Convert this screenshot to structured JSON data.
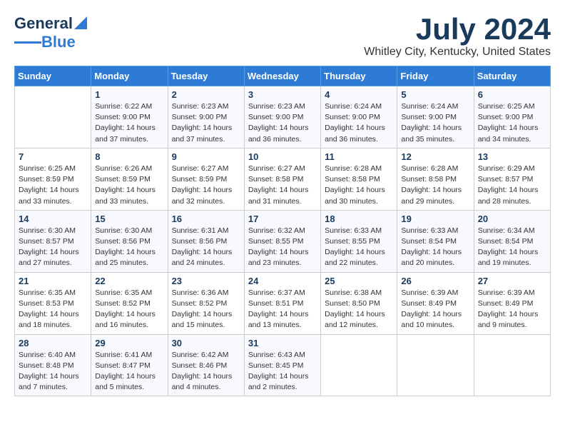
{
  "header": {
    "logo": {
      "line1": "General",
      "line2": "Blue"
    },
    "month": "July 2024",
    "location": "Whitley City, Kentucky, United States"
  },
  "weekdays": [
    "Sunday",
    "Monday",
    "Tuesday",
    "Wednesday",
    "Thursday",
    "Friday",
    "Saturday"
  ],
  "weeks": [
    [
      {
        "day": "",
        "info": ""
      },
      {
        "day": "1",
        "info": "Sunrise: 6:22 AM\nSunset: 9:00 PM\nDaylight: 14 hours\nand 37 minutes."
      },
      {
        "day": "2",
        "info": "Sunrise: 6:23 AM\nSunset: 9:00 PM\nDaylight: 14 hours\nand 37 minutes."
      },
      {
        "day": "3",
        "info": "Sunrise: 6:23 AM\nSunset: 9:00 PM\nDaylight: 14 hours\nand 36 minutes."
      },
      {
        "day": "4",
        "info": "Sunrise: 6:24 AM\nSunset: 9:00 PM\nDaylight: 14 hours\nand 36 minutes."
      },
      {
        "day": "5",
        "info": "Sunrise: 6:24 AM\nSunset: 9:00 PM\nDaylight: 14 hours\nand 35 minutes."
      },
      {
        "day": "6",
        "info": "Sunrise: 6:25 AM\nSunset: 9:00 PM\nDaylight: 14 hours\nand 34 minutes."
      }
    ],
    [
      {
        "day": "7",
        "info": "Sunrise: 6:25 AM\nSunset: 8:59 PM\nDaylight: 14 hours\nand 33 minutes."
      },
      {
        "day": "8",
        "info": "Sunrise: 6:26 AM\nSunset: 8:59 PM\nDaylight: 14 hours\nand 33 minutes."
      },
      {
        "day": "9",
        "info": "Sunrise: 6:27 AM\nSunset: 8:59 PM\nDaylight: 14 hours\nand 32 minutes."
      },
      {
        "day": "10",
        "info": "Sunrise: 6:27 AM\nSunset: 8:58 PM\nDaylight: 14 hours\nand 31 minutes."
      },
      {
        "day": "11",
        "info": "Sunrise: 6:28 AM\nSunset: 8:58 PM\nDaylight: 14 hours\nand 30 minutes."
      },
      {
        "day": "12",
        "info": "Sunrise: 6:28 AM\nSunset: 8:58 PM\nDaylight: 14 hours\nand 29 minutes."
      },
      {
        "day": "13",
        "info": "Sunrise: 6:29 AM\nSunset: 8:57 PM\nDaylight: 14 hours\nand 28 minutes."
      }
    ],
    [
      {
        "day": "14",
        "info": "Sunrise: 6:30 AM\nSunset: 8:57 PM\nDaylight: 14 hours\nand 27 minutes."
      },
      {
        "day": "15",
        "info": "Sunrise: 6:30 AM\nSunset: 8:56 PM\nDaylight: 14 hours\nand 25 minutes."
      },
      {
        "day": "16",
        "info": "Sunrise: 6:31 AM\nSunset: 8:56 PM\nDaylight: 14 hours\nand 24 minutes."
      },
      {
        "day": "17",
        "info": "Sunrise: 6:32 AM\nSunset: 8:55 PM\nDaylight: 14 hours\nand 23 minutes."
      },
      {
        "day": "18",
        "info": "Sunrise: 6:33 AM\nSunset: 8:55 PM\nDaylight: 14 hours\nand 22 minutes."
      },
      {
        "day": "19",
        "info": "Sunrise: 6:33 AM\nSunset: 8:54 PM\nDaylight: 14 hours\nand 20 minutes."
      },
      {
        "day": "20",
        "info": "Sunrise: 6:34 AM\nSunset: 8:54 PM\nDaylight: 14 hours\nand 19 minutes."
      }
    ],
    [
      {
        "day": "21",
        "info": "Sunrise: 6:35 AM\nSunset: 8:53 PM\nDaylight: 14 hours\nand 18 minutes."
      },
      {
        "day": "22",
        "info": "Sunrise: 6:35 AM\nSunset: 8:52 PM\nDaylight: 14 hours\nand 16 minutes."
      },
      {
        "day": "23",
        "info": "Sunrise: 6:36 AM\nSunset: 8:52 PM\nDaylight: 14 hours\nand 15 minutes."
      },
      {
        "day": "24",
        "info": "Sunrise: 6:37 AM\nSunset: 8:51 PM\nDaylight: 14 hours\nand 13 minutes."
      },
      {
        "day": "25",
        "info": "Sunrise: 6:38 AM\nSunset: 8:50 PM\nDaylight: 14 hours\nand 12 minutes."
      },
      {
        "day": "26",
        "info": "Sunrise: 6:39 AM\nSunset: 8:49 PM\nDaylight: 14 hours\nand 10 minutes."
      },
      {
        "day": "27",
        "info": "Sunrise: 6:39 AM\nSunset: 8:49 PM\nDaylight: 14 hours\nand 9 minutes."
      }
    ],
    [
      {
        "day": "28",
        "info": "Sunrise: 6:40 AM\nSunset: 8:48 PM\nDaylight: 14 hours\nand 7 minutes."
      },
      {
        "day": "29",
        "info": "Sunrise: 6:41 AM\nSunset: 8:47 PM\nDaylight: 14 hours\nand 5 minutes."
      },
      {
        "day": "30",
        "info": "Sunrise: 6:42 AM\nSunset: 8:46 PM\nDaylight: 14 hours\nand 4 minutes."
      },
      {
        "day": "31",
        "info": "Sunrise: 6:43 AM\nSunset: 8:45 PM\nDaylight: 14 hours\nand 2 minutes."
      },
      {
        "day": "",
        "info": ""
      },
      {
        "day": "",
        "info": ""
      },
      {
        "day": "",
        "info": ""
      }
    ]
  ]
}
